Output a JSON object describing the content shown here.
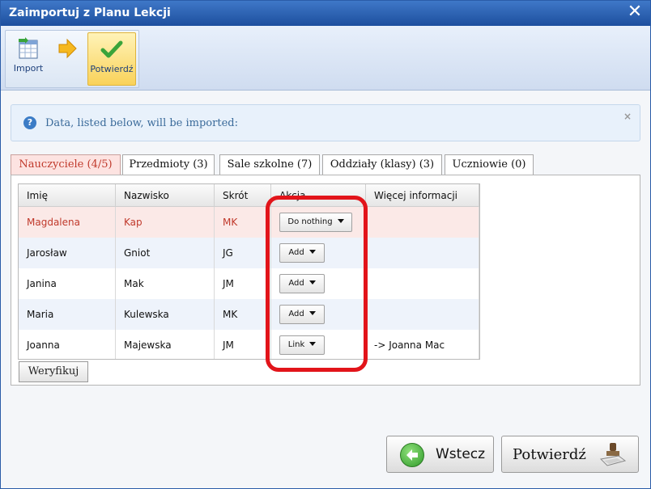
{
  "window": {
    "title": "Zaimportuj z Planu Lekcji"
  },
  "ribbon": {
    "import_label": "Import",
    "confirm_label": "Potwierdź"
  },
  "info": {
    "message": "Data, listed below, will be imported:",
    "close_glyph": "×"
  },
  "tabs": [
    {
      "label": "Nauczyciele (4/5)",
      "active": true
    },
    {
      "label": "Przedmioty (3)"
    },
    {
      "label": "Sale szkolne (7)"
    },
    {
      "label": "Oddziały (klasy) (3)"
    },
    {
      "label": "Uczniowie (0)"
    }
  ],
  "grid": {
    "headers": [
      "Imię",
      "Nazwisko",
      "Skrót",
      "Akcja",
      "Więcej informacji"
    ],
    "rows": [
      {
        "first": "Magdalena",
        "last": "Kap",
        "short": "MK",
        "action": "Do nothing",
        "info": ""
      },
      {
        "first": "Jarosław",
        "last": "Gniot",
        "short": "JG",
        "action": "Add",
        "info": ""
      },
      {
        "first": "Janina",
        "last": "Mak",
        "short": "JM",
        "action": "Add",
        "info": ""
      },
      {
        "first": "Maria",
        "last": "Kulewska",
        "short": "MK",
        "action": "Add",
        "info": ""
      },
      {
        "first": "Joanna",
        "last": "Majewska",
        "short": "JM",
        "action": "Link",
        "info": "-> Joanna Mac"
      }
    ]
  },
  "buttons": {
    "verify": "Weryfikuj",
    "back": "Wstecz",
    "confirm": "Potwierdź"
  },
  "colors": {
    "title_bar": "#1d4f9e",
    "selected_row_text": "#c0392b",
    "highlight": "#e2141a"
  }
}
